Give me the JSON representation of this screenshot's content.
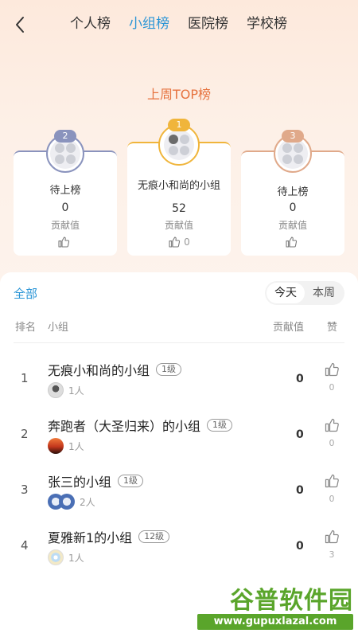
{
  "nav": {
    "tabs": [
      {
        "label": "个人榜"
      },
      {
        "label": "小组榜"
      },
      {
        "label": "医院榜"
      },
      {
        "label": "学校榜"
      }
    ],
    "active_tab": "小组榜"
  },
  "top": {
    "title": "上周TOP榜",
    "cards": [
      {
        "rank": "2",
        "name": "待上榜",
        "value": "0",
        "value_label": "贡献值",
        "likes": ""
      },
      {
        "rank": "1",
        "name": "无痕小和尚的小组",
        "value": "52",
        "value_label": "贡献值",
        "likes": "0"
      },
      {
        "rank": "3",
        "name": "待上榜",
        "value": "0",
        "value_label": "贡献值",
        "likes": ""
      }
    ]
  },
  "list": {
    "all_label": "全部",
    "segments": [
      {
        "label": "今天"
      },
      {
        "label": "本周"
      }
    ],
    "active_segment": "今天",
    "headers": {
      "rank": "排名",
      "group": "小组",
      "score": "贡献值",
      "likes": "赞"
    },
    "rows": [
      {
        "rank": "1",
        "name": "无痕小和尚的小组",
        "level": "1级",
        "members": "1人",
        "score": "0",
        "likes": "0"
      },
      {
        "rank": "2",
        "name": "奔跑者（大圣归来）的小组",
        "level": "1级",
        "members": "1人",
        "score": "0",
        "likes": "0"
      },
      {
        "rank": "3",
        "name": "张三的小组",
        "level": "1级",
        "members": "2人",
        "score": "0",
        "likes": "0"
      },
      {
        "rank": "4",
        "name": "夏雅新1的小组",
        "level": "12级",
        "members": "1人",
        "score": "0",
        "likes": "3"
      }
    ]
  },
  "watermark": {
    "title": "谷普软件园",
    "url": "www.gupuxlazal.com"
  },
  "colors": {
    "accent": "#2a95d6",
    "top_title": "#e6733f",
    "rank1": "#f0b53b",
    "rank2": "#8a93bd",
    "rank3": "#e0a98a"
  }
}
